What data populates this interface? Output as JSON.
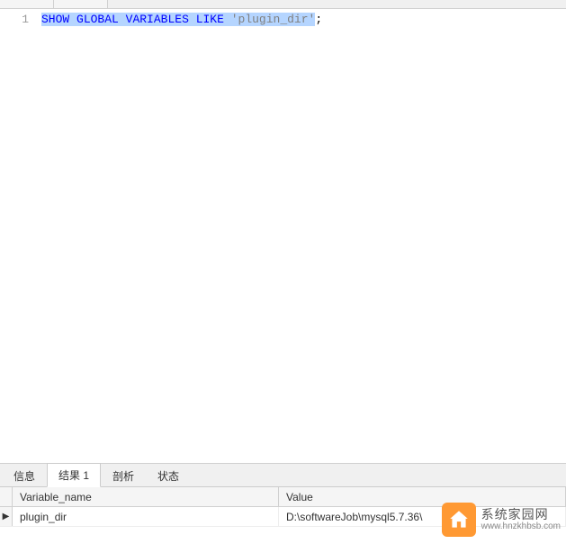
{
  "editor": {
    "line_number": "1",
    "sql": {
      "kw1": "SHOW",
      "kw2": "GLOBAL",
      "kw3": "VARIABLES",
      "kw4": "LIKE",
      "str": "'plugin_dir'",
      "semi": ";"
    }
  },
  "tabs": {
    "info": "信息",
    "result": "结果 1",
    "analysis": "剖析",
    "status": "状态"
  },
  "grid": {
    "headers": {
      "col1": "Variable_name",
      "col2": "Value"
    },
    "row_indicator": "▶",
    "rows": [
      {
        "variable_name": "plugin_dir",
        "value": "D:\\softwareJob\\mysql5.7.36\\"
      }
    ]
  },
  "watermark": {
    "title": "系统家园网",
    "url": "www.hnzkhbsb.com"
  }
}
